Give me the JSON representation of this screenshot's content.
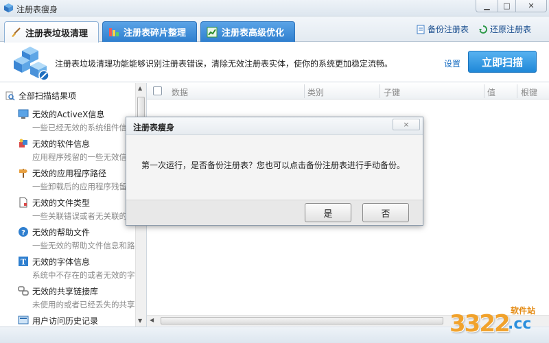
{
  "window": {
    "title": "注册表瘦身"
  },
  "tabs": [
    {
      "label": "注册表垃圾清理",
      "active": true
    },
    {
      "label": "注册表碎片整理",
      "active": false
    },
    {
      "label": "注册表高级优化",
      "active": false
    }
  ],
  "toolbar": {
    "backup_label": "备份注册表",
    "restore_label": "还原注册表"
  },
  "info": {
    "description": "注册表垃圾清理功能能够识别注册表错误，清除无效注册表实体，使你的系统更加稳定流畅。",
    "settings_label": "设置",
    "scan_label": "立即扫描"
  },
  "tree": {
    "root_label": "全部扫描结果项",
    "items": [
      {
        "label": "无效的ActiveX信息",
        "desc": "一些已经无效的系统组件信息"
      },
      {
        "label": "无效的软件信息",
        "desc": "应用程序残留的一些无效信息"
      },
      {
        "label": "无效的应用程序路径",
        "desc": "一些卸载后的应用程序残留信息"
      },
      {
        "label": "无效的文件类型",
        "desc": "一些关联错误或者无关联的文件类型"
      },
      {
        "label": "无效的帮助文件",
        "desc": "一些无效的帮助文件信息和路径"
      },
      {
        "label": "无效的字体信息",
        "desc": "系统中不存在的或者无效的字体"
      },
      {
        "label": "无效的共享链接库",
        "desc": "未使用的或者已经丢失的共享链接库"
      },
      {
        "label": "用户访问历史记录",
        "desc": ""
      }
    ]
  },
  "table": {
    "columns": [
      "数据",
      "类别",
      "子键",
      "值",
      "根键"
    ]
  },
  "dialog": {
    "title": "注册表瘦身",
    "close_label": "×",
    "message": "第一次运行，是否备份注册表？您也可以点击备份注册表进行手动备份。",
    "yes_label": "是",
    "no_label": "否"
  },
  "watermark": {
    "number": "3322",
    "suffix": ".cc",
    "site": "软件站"
  },
  "colors": {
    "accent": "#2f7fcf",
    "scan_button": "#1f88d8",
    "link": "#1b6fc2"
  }
}
